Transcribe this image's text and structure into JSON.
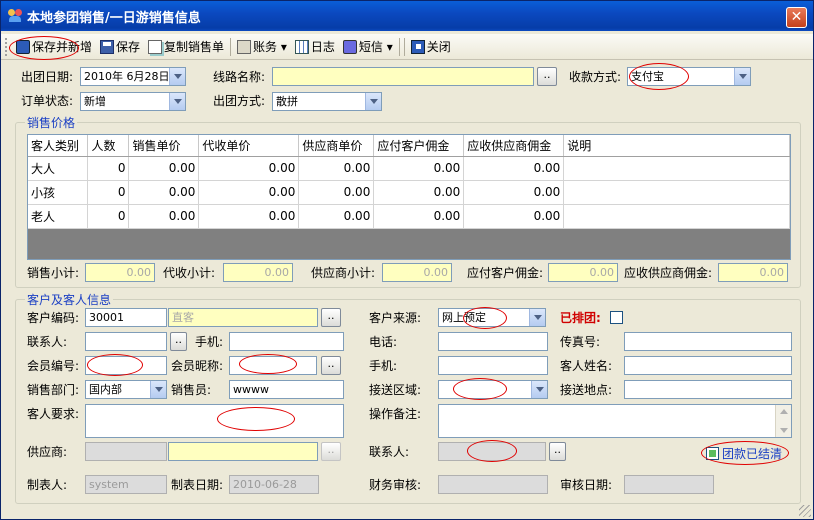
{
  "window": {
    "title": "本地参团销售/一日游销售信息",
    "close_label": "✕"
  },
  "toolbar": {
    "save_new": "保存并新增",
    "save": "保存",
    "copy_order": "复制销售单",
    "account": "账务",
    "log": "日志",
    "sms": "短信",
    "close": "关闭"
  },
  "header": {
    "depart_date_label": "出团日期:",
    "depart_date_value": "2010年  6月28日",
    "route_label": "线路名称:",
    "route_value": "",
    "payment_label": "收款方式:",
    "payment_value": "支付宝",
    "order_status_label": "订单状态:",
    "order_status_value": "新增",
    "tour_type_label": "出团方式:",
    "tour_type_value": "散拼"
  },
  "sales": {
    "group_title": "销售价格",
    "columns": [
      "客人类别",
      "人数",
      "销售单价",
      "代收单价",
      "供应商单价",
      "应付客户佣金",
      "应收供应商佣金",
      "说明"
    ],
    "rows": [
      [
        "大人",
        "0",
        "0.00",
        "0.00",
        "0.00",
        "0.00",
        "0.00",
        ""
      ],
      [
        "小孩",
        "0",
        "0.00",
        "0.00",
        "0.00",
        "0.00",
        "0.00",
        ""
      ],
      [
        "老人",
        "0",
        "0.00",
        "0.00",
        "0.00",
        "0.00",
        "0.00",
        ""
      ]
    ],
    "subtotal_label": "销售小计:",
    "subtotal_value": "0.00",
    "collect_label": "代收小计:",
    "collect_value": "0.00",
    "supplier_label": "供应商小计:",
    "supplier_value": "0.00",
    "pay_comm_label": "应付客户佣金:",
    "pay_comm_value": "0.00",
    "recv_comm_label": "应收供应商佣金:",
    "recv_comm_value": "0.00"
  },
  "customer": {
    "group_title": "客户及客人信息",
    "code_label": "客户编码:",
    "code_value": "30001",
    "name_value": "直客",
    "source_label": "客户来源:",
    "source_value": "网上预定",
    "arranged_label": "已排团:",
    "contact_label": "联系人:",
    "contact_value": "",
    "mobile_label": "手机:",
    "mobile_value": "",
    "phone_label": "电话:",
    "phone_value": "",
    "fax_label": "传真号:",
    "fax_value": "",
    "member_no_label": "会员编号:",
    "member_no_value": "",
    "member_nick_label": "会员昵称:",
    "member_nick_value": "",
    "mobile2_label": "手机:",
    "mobile2_value": "",
    "guest_name_label": "客人姓名:",
    "guest_name_value": "",
    "dept_label": "销售部门:",
    "dept_value": "国内部",
    "seller_label": "销售员:",
    "seller_value": "wwww",
    "pickup_area_label": "接送区域:",
    "pickup_area_value": "",
    "pickup_place_label": "接送地点:",
    "pickup_place_value": "",
    "guest_req_label": "客人要求:",
    "guest_req_value": "",
    "op_note_label": "操作备注:",
    "op_note_value": "",
    "supplier_label": "供应商:",
    "supplier_value": "",
    "supplier_name_value": "",
    "supplier_contact_label": "联系人:",
    "supplier_contact_value": "",
    "settled_label": "团款已结清",
    "creator_label": "制表人:",
    "creator_value": "system",
    "create_date_label": "制表日期:",
    "create_date_value": "2010-06-28",
    "fin_review_label": "财务审核:",
    "fin_review_value": "",
    "review_date_label": "审核日期:",
    "review_date_value": ""
  },
  "button_dots": "..",
  "colors": {
    "title_bar": "#0b49c0",
    "annotation": "#e00000",
    "required_field": "#ffffc0",
    "group_title": "#1a3fc4"
  }
}
